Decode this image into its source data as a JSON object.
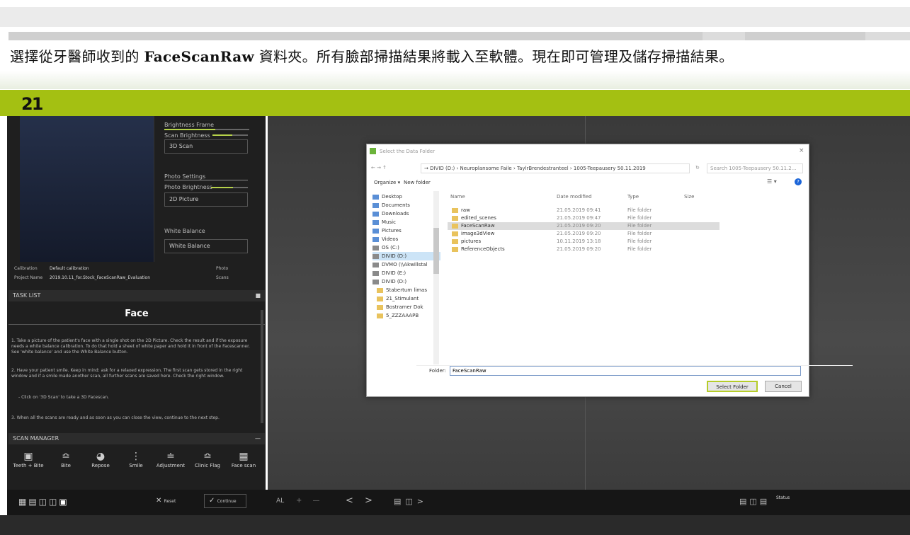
{
  "caption": {
    "pre": "選擇從牙醫師收到的",
    "bold": "FaceScanRaw",
    "post": "資料夾。所有臉部掃描結果將載入至軟體。現在即可管理及儲存掃描結果。"
  },
  "app": {
    "logo": "21"
  },
  "left": {
    "exposure_label": "Brightness Frame",
    "scan_brightness_label": "Scan Brightness",
    "btn_3d_scan": "3D Scan",
    "photo_settings_label": "Photo Settings",
    "photo_brightness_label": "Photo Brightness",
    "btn_2d_picture": "2D Picture",
    "white_balance_label": "White Balance",
    "btn_white_balance": "White Balance",
    "calib_label": "Calibration",
    "calib_value": "Default calibration",
    "project_label": "Project Name",
    "project_value": "2019.10.11_for.Stock_FaceScanRaw_Evaluation",
    "photo_small": "Photo",
    "scans_small": "Scans",
    "tasklist_header": "TASK LIST",
    "task_title": "Face",
    "task_paras": [
      "1. Take a picture of the patient's face with a single shot on the 2D Picture. Check the result and if the exposure needs a white balance calibration. To do that hold a sheet of white paper and hold it in front of the Facescanner. See 'white balance' and use the White Balance button.",
      "2. Have your patient smile. Keep in mind: ask for a relaxed expression. The first scan gets stored in the right window and if a smile made another scan, all further scans are saved here. Check the right window.",
      "- Click on '3D Scan' to take a 3D Facescan.",
      "3. When all the scans are ready and as soon as you can close the view, continue to the next step."
    ],
    "scanmanager_header": "SCAN MANAGER",
    "scan_icons": [
      "Teeth + Bite",
      "Bite",
      "Repose",
      "Smile",
      "Adjustment",
      "Clinic Flag",
      "Face scan"
    ]
  },
  "bottombar": {
    "reset_label": "Reset",
    "continue_label": "Continue",
    "all_label": "AL",
    "status_label": "Status"
  },
  "dialog": {
    "title": "Select the Data Folder",
    "address": "→ DIVID (D:) › Neuroplansome Faile › TaylrBrendestranteel › 1005-Teepausery 50.11.2019",
    "search_placeholder": "Search 1005-Teepausery 50.11.2...",
    "organize": "Organize ▾",
    "new_folder": "New folder",
    "columns": [
      "Name",
      "Date modified",
      "Type",
      "Size"
    ],
    "tree": [
      "Desktop",
      "Documents",
      "Downloads",
      "Music",
      "Pictures",
      "Videos",
      "OS (C:)",
      "DIVID (D:)",
      "DVMO (\\\\Akwillstal",
      "DIVID (E:)",
      "DIVID (D:)",
      "Stabertum limas",
      "21_Stimulant",
      "Bostramer Dok",
      "5_ZZZAAAPB"
    ],
    "files": [
      {
        "name": "raw",
        "date": "21.05.2019 09:41",
        "type": "File folder"
      },
      {
        "name": "edited_scenes",
        "date": "21.05.2019 09:47",
        "type": "File folder"
      },
      {
        "name": "FaceScanRaw",
        "date": "21.05.2019 09:20",
        "type": "File folder",
        "selected": true
      },
      {
        "name": "image3dView",
        "date": "21.05.2019 09:20",
        "type": "File folder"
      },
      {
        "name": "pictures",
        "date": "10.11.2019 13:18",
        "type": "File folder"
      },
      {
        "name": "ReferenceObjects",
        "date": "21.05.2019 09:20",
        "type": "File folder"
      }
    ],
    "folder_label": "Folder:",
    "folder_value": "FaceScanRaw",
    "select_btn": "Select Folder",
    "cancel_btn": "Cancel"
  }
}
